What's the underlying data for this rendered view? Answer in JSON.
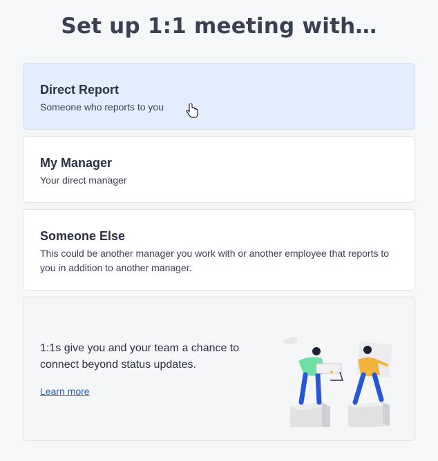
{
  "header": {
    "title": "Set up 1:1 meeting with…"
  },
  "options": [
    {
      "title": "Direct Report",
      "description": "Someone who reports to you"
    },
    {
      "title": "My Manager",
      "description": "Your direct manager"
    },
    {
      "title": "Someone Else",
      "description": "This could be another manager you work with or another employee that reports to you in addition to another manager."
    }
  ],
  "info": {
    "text": "1:1s give you and your team a chance to connect beyond status updates.",
    "link": "Learn more"
  },
  "icons": {
    "cursor": "hand-pointer-icon",
    "illustration": "two-people-meeting-illustration"
  },
  "colors": {
    "selected_bg": "#e3edfd",
    "link": "#1a63c9",
    "accent_green": "#6ee0a6",
    "accent_yellow": "#f3b33d",
    "accent_blue": "#2756d6"
  }
}
